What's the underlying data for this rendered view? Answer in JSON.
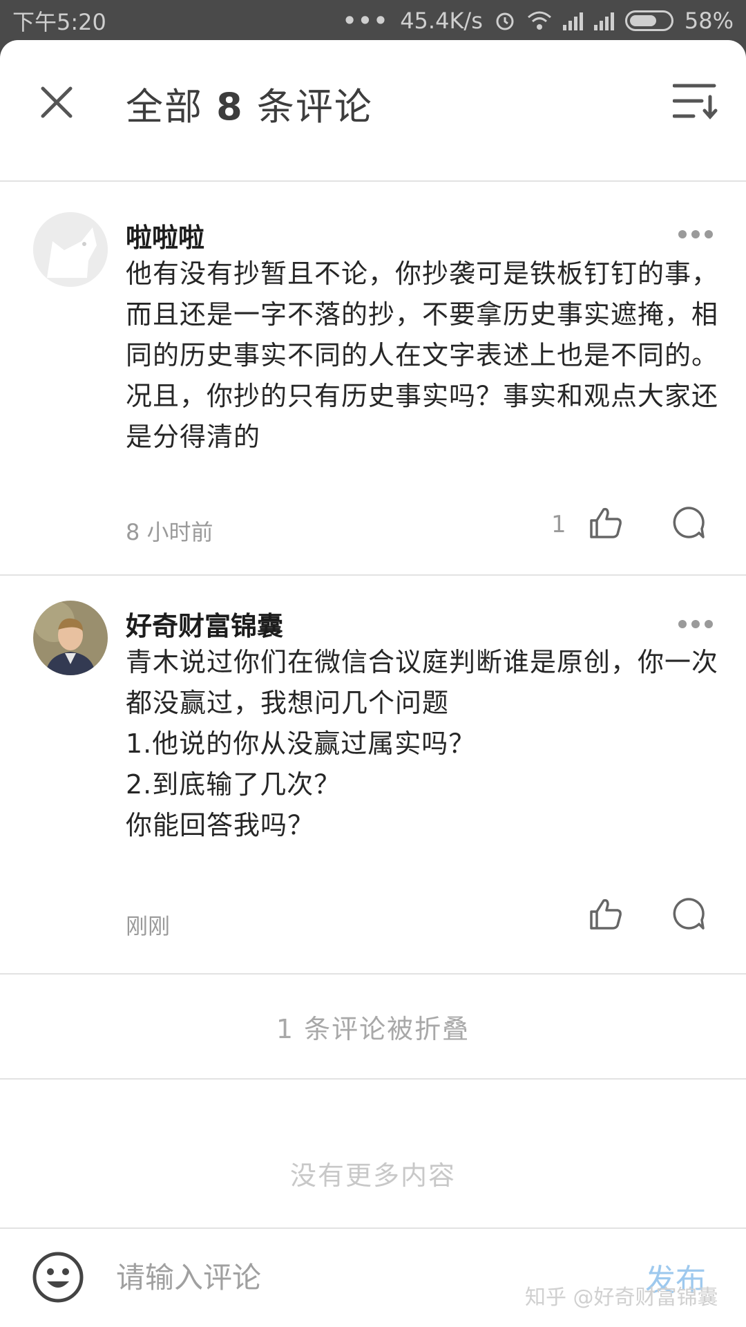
{
  "status_bar": {
    "time": "下午5:20",
    "network_speed": "45.4K/s",
    "network_type": "4G\n1X",
    "battery": "58%"
  },
  "header": {
    "title_prefix": "全部",
    "count": "8",
    "title_suffix": "条评论"
  },
  "comments": [
    {
      "author": "啦啦啦",
      "content": "他有没有抄暂且不论，你抄袭可是铁板钉钉的事，而且还是一字不落的抄，不要拿历史事实遮掩，相同的历史事实不同的人在文字表述上也是不同的。况且，你抄的只有历史事实吗？事实和观点大家还是分得清的",
      "time": "8 小时前",
      "likes": "1"
    },
    {
      "author": "好奇财富锦囊",
      "content": "青木说过你们在微信合议庭判断谁是原创，你一次都没赢过，我想问几个问题\n1.他说的你从没赢过属实吗？\n2.到底输了几次？\n你能回答我吗？",
      "time": "刚刚",
      "likes": ""
    }
  ],
  "folded_text": "1 条评论被折叠",
  "no_more_text": "没有更多内容",
  "input": {
    "placeholder": "请输入评论",
    "publish_label": "发布"
  },
  "watermark": "知乎 @好奇财富锦囊",
  "colors": {
    "status_bar_bg": "#4a4a4a",
    "publish_disabled": "#9ec9ee",
    "secondary_text": "#9a9a9a"
  }
}
